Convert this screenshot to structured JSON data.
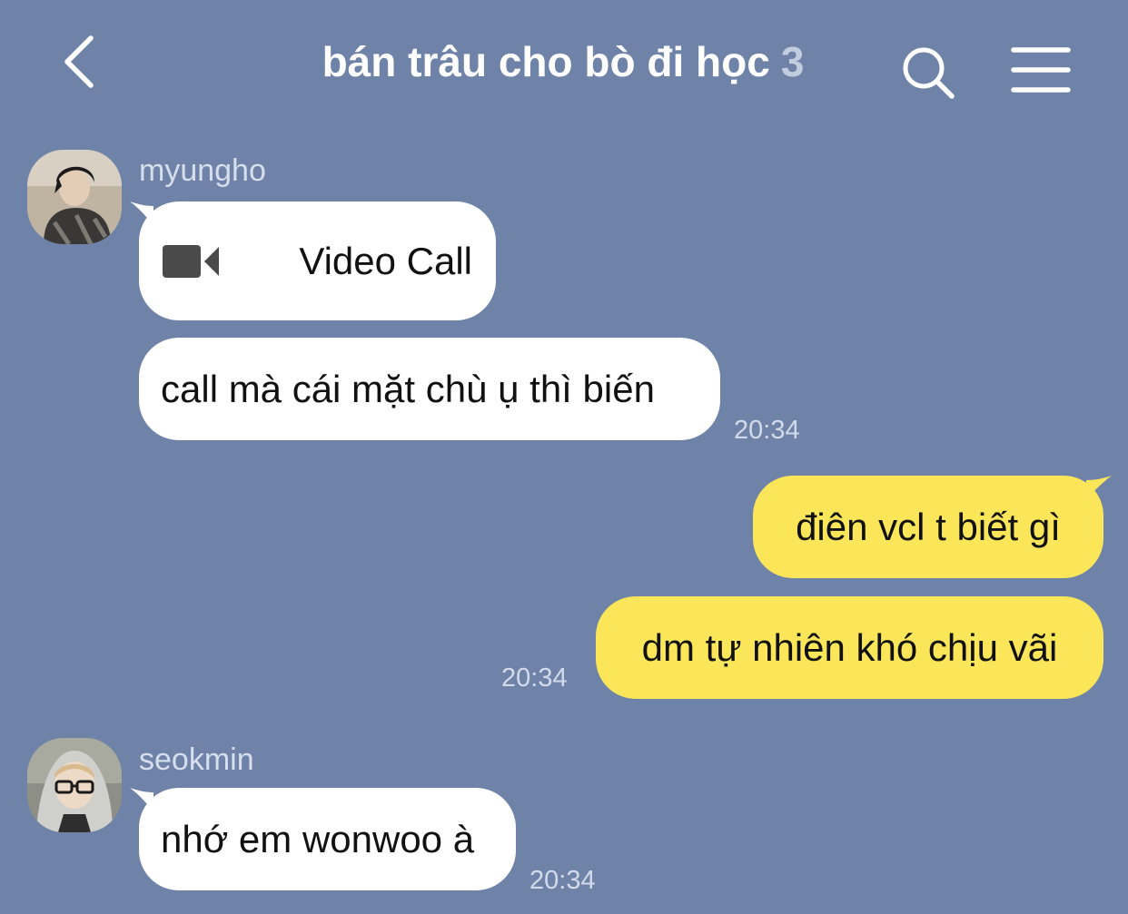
{
  "header": {
    "back_icon": "chevron-left-icon",
    "title": "bán trâu cho bò đi học",
    "member_count": "3",
    "search_icon": "search-icon",
    "menu_icon": "hamburger-menu-icon"
  },
  "colors": {
    "background": "#6f82a8",
    "incoming_bubble": "#ffffff",
    "outgoing_bubble": "#fae658",
    "timestamp": "#d3dbea"
  },
  "messages": [
    {
      "direction": "incoming",
      "sender": "myungho",
      "type": "video-call",
      "icon": "video-camera-icon",
      "text": "Video Call"
    },
    {
      "direction": "incoming",
      "sender": "myungho",
      "type": "text",
      "text": "call mà cái mặt chù ụ thì biến",
      "time": "20:34"
    },
    {
      "direction": "outgoing",
      "type": "text",
      "text": "điên vcl t biết gì"
    },
    {
      "direction": "outgoing",
      "type": "text",
      "text": "dm tự nhiên khó chịu vãi",
      "time": "20:34"
    },
    {
      "direction": "incoming",
      "sender": "seokmin",
      "type": "text",
      "text": "nhớ em wonwoo à",
      "time": "20:34"
    }
  ]
}
